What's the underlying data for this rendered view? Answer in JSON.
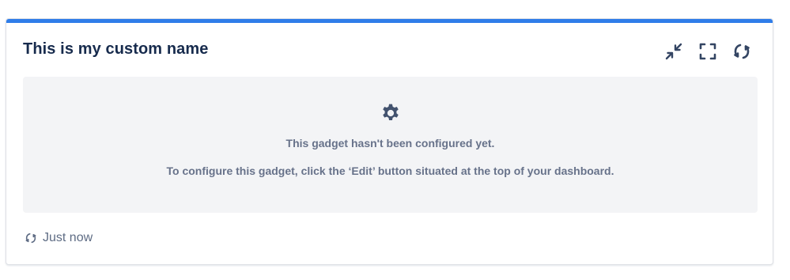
{
  "gadget": {
    "title": "This is my custom name",
    "accent_color": "#2f7de9",
    "actions": [
      {
        "name": "minimize",
        "icon": "collapse-arrows-icon"
      },
      {
        "name": "maximize",
        "icon": "fullscreen-icon"
      },
      {
        "name": "refresh",
        "icon": "refresh-icon"
      }
    ],
    "message": {
      "icon": "gear-icon",
      "line1": "This gadget hasn't been configured yet.",
      "line2": "To configure this gadget, click the ‘Edit’ button situated at the top of your dashboard."
    },
    "footer": {
      "icon": "refresh-icon",
      "last_updated": "Just now"
    }
  }
}
